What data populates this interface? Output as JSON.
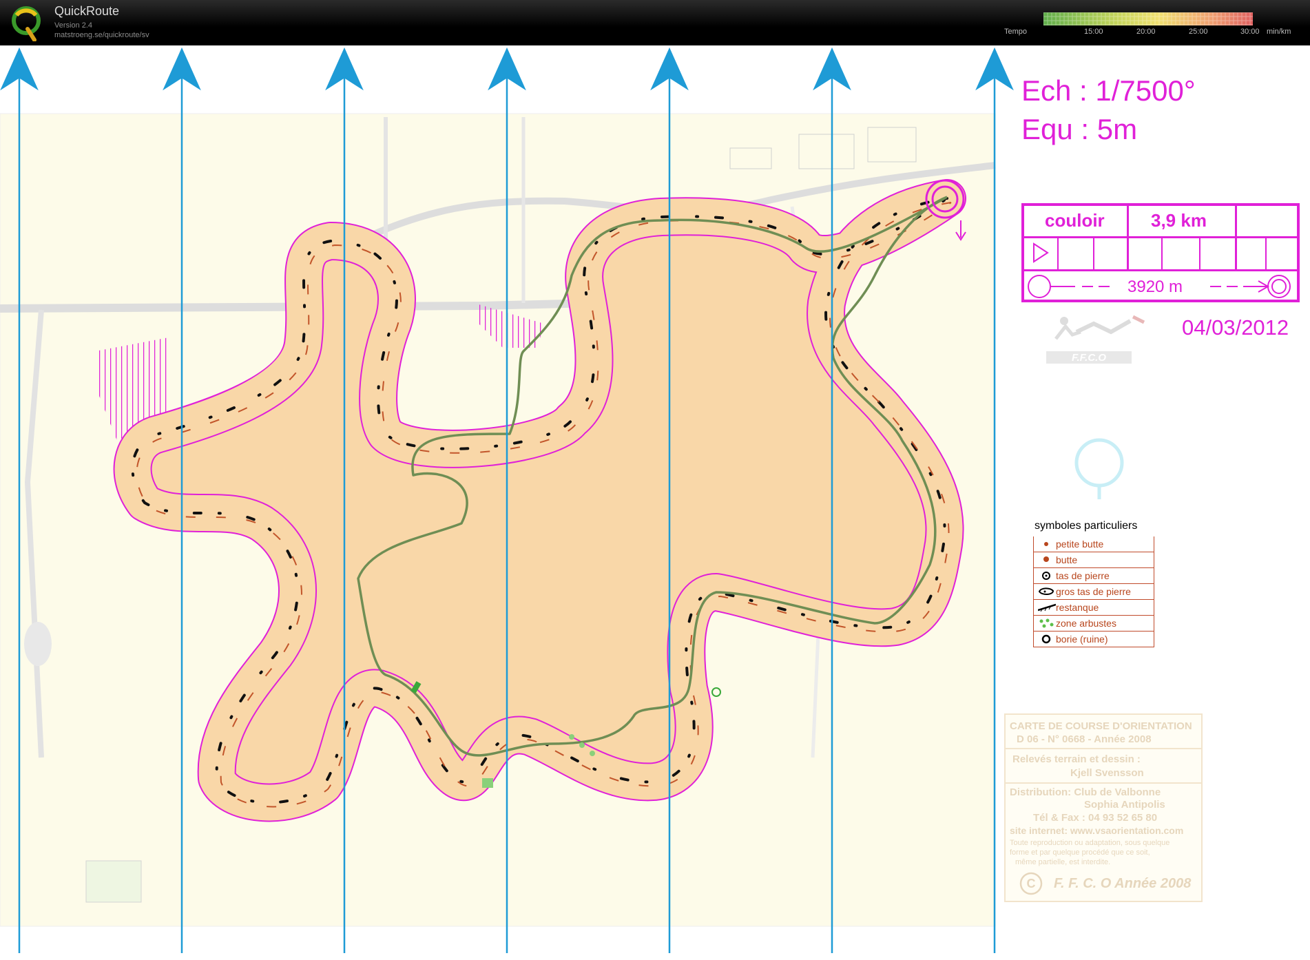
{
  "app": {
    "name": "QuickRoute",
    "version": "Version 2.4",
    "url": "matstroeng.se/quickroute/sv",
    "logo_letter": "Q"
  },
  "tempo": {
    "label": "Tempo",
    "ticks": [
      "15:00",
      "20:00",
      "25:00",
      "30:00"
    ],
    "unit": "min/km"
  },
  "map": {
    "scale": "Ech : 1/7500°",
    "equidistance": "Equ : 5m",
    "course_name": "couloir",
    "course_length": "3,9 km",
    "course_distance": "3920 m",
    "date": "04/03/2012",
    "club_logo_text": "F.F.C.O",
    "legend": {
      "title": "symboles particuliers",
      "items": [
        {
          "label": "petite butte",
          "symbol": "small-dot"
        },
        {
          "label": "butte",
          "symbol": "dot"
        },
        {
          "label": "tas de pierre",
          "symbol": "circle-dot"
        },
        {
          "label": "gros tas de pierre",
          "symbol": "blob"
        },
        {
          "label": "restanque",
          "symbol": "wall"
        },
        {
          "label": "zone arbustes",
          "symbol": "green-dots"
        },
        {
          "label": "borie (ruine)",
          "symbol": "ring"
        }
      ]
    },
    "info_box": [
      "CARTE DE COURSE D'ORIENTATION",
      "D 06 - N° 0668 - Année 2008",
      "Relevés terrain  et dessin :",
      "Kjell Svensson",
      "Distribution:    Club de Valbonne",
      "Sophia Antipolis",
      "Tél & Fax : 04 93 52 65 80",
      "site internet: www.vsaorientation.com",
      "Toute reproduction ou adaptation, sous quelque",
      "forme et par quelque procédé  que ce soit,",
      "même partielle, est interdite.",
      "F. F. C. O Année 2008"
    ],
    "colors": {
      "course": "#e020d8",
      "route": "#6f8e54",
      "north_lines": "#1e9bd6",
      "corridor_fill": "#f9d7a8",
      "legend_text": "#b8461d"
    }
  }
}
